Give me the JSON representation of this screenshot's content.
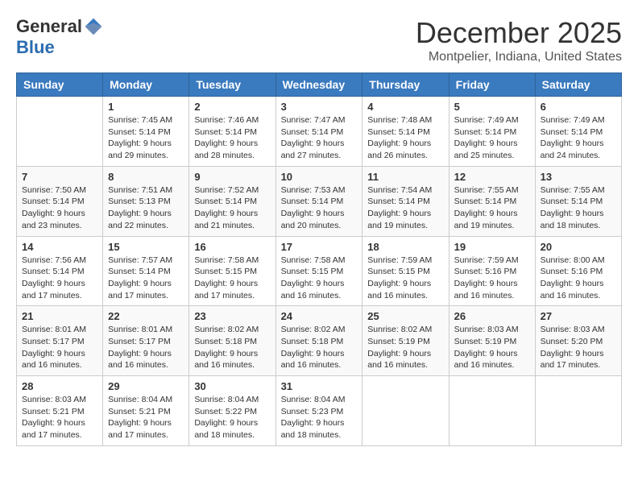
{
  "logo": {
    "general": "General",
    "blue": "Blue"
  },
  "header": {
    "month": "December 2025",
    "location": "Montpelier, Indiana, United States"
  },
  "days_of_week": [
    "Sunday",
    "Monday",
    "Tuesday",
    "Wednesday",
    "Thursday",
    "Friday",
    "Saturday"
  ],
  "weeks": [
    [
      {
        "day": "",
        "info": ""
      },
      {
        "day": "1",
        "info": "Sunrise: 7:45 AM\nSunset: 5:14 PM\nDaylight: 9 hours\nand 29 minutes."
      },
      {
        "day": "2",
        "info": "Sunrise: 7:46 AM\nSunset: 5:14 PM\nDaylight: 9 hours\nand 28 minutes."
      },
      {
        "day": "3",
        "info": "Sunrise: 7:47 AM\nSunset: 5:14 PM\nDaylight: 9 hours\nand 27 minutes."
      },
      {
        "day": "4",
        "info": "Sunrise: 7:48 AM\nSunset: 5:14 PM\nDaylight: 9 hours\nand 26 minutes."
      },
      {
        "day": "5",
        "info": "Sunrise: 7:49 AM\nSunset: 5:14 PM\nDaylight: 9 hours\nand 25 minutes."
      },
      {
        "day": "6",
        "info": "Sunrise: 7:49 AM\nSunset: 5:14 PM\nDaylight: 9 hours\nand 24 minutes."
      }
    ],
    [
      {
        "day": "7",
        "info": "Sunrise: 7:50 AM\nSunset: 5:14 PM\nDaylight: 9 hours\nand 23 minutes."
      },
      {
        "day": "8",
        "info": "Sunrise: 7:51 AM\nSunset: 5:13 PM\nDaylight: 9 hours\nand 22 minutes."
      },
      {
        "day": "9",
        "info": "Sunrise: 7:52 AM\nSunset: 5:14 PM\nDaylight: 9 hours\nand 21 minutes."
      },
      {
        "day": "10",
        "info": "Sunrise: 7:53 AM\nSunset: 5:14 PM\nDaylight: 9 hours\nand 20 minutes."
      },
      {
        "day": "11",
        "info": "Sunrise: 7:54 AM\nSunset: 5:14 PM\nDaylight: 9 hours\nand 19 minutes."
      },
      {
        "day": "12",
        "info": "Sunrise: 7:55 AM\nSunset: 5:14 PM\nDaylight: 9 hours\nand 19 minutes."
      },
      {
        "day": "13",
        "info": "Sunrise: 7:55 AM\nSunset: 5:14 PM\nDaylight: 9 hours\nand 18 minutes."
      }
    ],
    [
      {
        "day": "14",
        "info": "Sunrise: 7:56 AM\nSunset: 5:14 PM\nDaylight: 9 hours\nand 17 minutes."
      },
      {
        "day": "15",
        "info": "Sunrise: 7:57 AM\nSunset: 5:14 PM\nDaylight: 9 hours\nand 17 minutes."
      },
      {
        "day": "16",
        "info": "Sunrise: 7:58 AM\nSunset: 5:15 PM\nDaylight: 9 hours\nand 17 minutes."
      },
      {
        "day": "17",
        "info": "Sunrise: 7:58 AM\nSunset: 5:15 PM\nDaylight: 9 hours\nand 16 minutes."
      },
      {
        "day": "18",
        "info": "Sunrise: 7:59 AM\nSunset: 5:15 PM\nDaylight: 9 hours\nand 16 minutes."
      },
      {
        "day": "19",
        "info": "Sunrise: 7:59 AM\nSunset: 5:16 PM\nDaylight: 9 hours\nand 16 minutes."
      },
      {
        "day": "20",
        "info": "Sunrise: 8:00 AM\nSunset: 5:16 PM\nDaylight: 9 hours\nand 16 minutes."
      }
    ],
    [
      {
        "day": "21",
        "info": "Sunrise: 8:01 AM\nSunset: 5:17 PM\nDaylight: 9 hours\nand 16 minutes."
      },
      {
        "day": "22",
        "info": "Sunrise: 8:01 AM\nSunset: 5:17 PM\nDaylight: 9 hours\nand 16 minutes."
      },
      {
        "day": "23",
        "info": "Sunrise: 8:02 AM\nSunset: 5:18 PM\nDaylight: 9 hours\nand 16 minutes."
      },
      {
        "day": "24",
        "info": "Sunrise: 8:02 AM\nSunset: 5:18 PM\nDaylight: 9 hours\nand 16 minutes."
      },
      {
        "day": "25",
        "info": "Sunrise: 8:02 AM\nSunset: 5:19 PM\nDaylight: 9 hours\nand 16 minutes."
      },
      {
        "day": "26",
        "info": "Sunrise: 8:03 AM\nSunset: 5:19 PM\nDaylight: 9 hours\nand 16 minutes."
      },
      {
        "day": "27",
        "info": "Sunrise: 8:03 AM\nSunset: 5:20 PM\nDaylight: 9 hours\nand 17 minutes."
      }
    ],
    [
      {
        "day": "28",
        "info": "Sunrise: 8:03 AM\nSunset: 5:21 PM\nDaylight: 9 hours\nand 17 minutes."
      },
      {
        "day": "29",
        "info": "Sunrise: 8:04 AM\nSunset: 5:21 PM\nDaylight: 9 hours\nand 17 minutes."
      },
      {
        "day": "30",
        "info": "Sunrise: 8:04 AM\nSunset: 5:22 PM\nDaylight: 9 hours\nand 18 minutes."
      },
      {
        "day": "31",
        "info": "Sunrise: 8:04 AM\nSunset: 5:23 PM\nDaylight: 9 hours\nand 18 minutes."
      },
      {
        "day": "",
        "info": ""
      },
      {
        "day": "",
        "info": ""
      },
      {
        "day": "",
        "info": ""
      }
    ]
  ]
}
